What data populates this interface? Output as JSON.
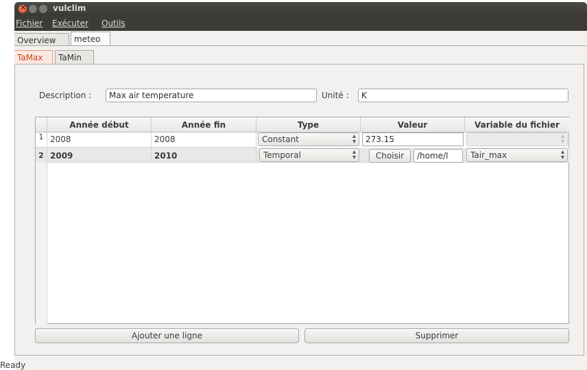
{
  "window": {
    "title": "vulclim"
  },
  "menubar": {
    "items": [
      "Fichier",
      "Exécuter",
      "Outils"
    ]
  },
  "tabs": [
    "Overview",
    "meteo"
  ],
  "subtabs": [
    "TaMax",
    "TaMin"
  ],
  "form": {
    "description_label": "Description :",
    "description_value": "Max air temperature",
    "unit_label": "Unité :",
    "unit_value": "K"
  },
  "table": {
    "headers": [
      "Année début",
      "Année fin",
      "Type",
      "Valeur",
      "Variable du fichier"
    ],
    "rows": [
      {
        "num": "1",
        "start": "2008",
        "end": "2008",
        "type": "Constant",
        "value": "273.15",
        "variable": ""
      },
      {
        "num": "2",
        "start": "2009",
        "end": "2010",
        "type": "Temporal",
        "choose_label": "Choisir",
        "path": "/home/l",
        "variable": "Tair_max"
      }
    ]
  },
  "buttons": {
    "add": "Ajouter une ligne",
    "delete": "Supprimer"
  },
  "status": "Ready"
}
